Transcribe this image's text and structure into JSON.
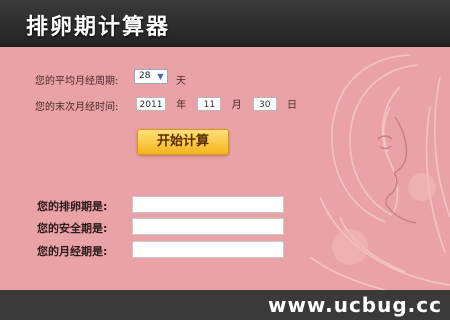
{
  "header": {
    "title": "排卵期计算器"
  },
  "form": {
    "cycle_label": "您的平均月经周期:",
    "cycle_value": "28",
    "cycle_unit": "天",
    "last_period_label": "您的末次月经时间:",
    "year_value": "2011",
    "year_unit": "年",
    "month_value": "11",
    "month_unit": "月",
    "day_value": "30",
    "day_unit": "日",
    "calculate_button": "开始计算"
  },
  "results": {
    "ovulation_label": "您的排卵期是:",
    "ovulation_value": "",
    "safe_label": "您的安全期是:",
    "safe_value": "",
    "menstrual_label": "您的月经期是:",
    "menstrual_value": ""
  },
  "watermark": "www.ucbug.cc",
  "colors": {
    "panel_bg": "#e9a2a6",
    "header_bg": "#2c2c2c",
    "button": "#f6b51c"
  }
}
